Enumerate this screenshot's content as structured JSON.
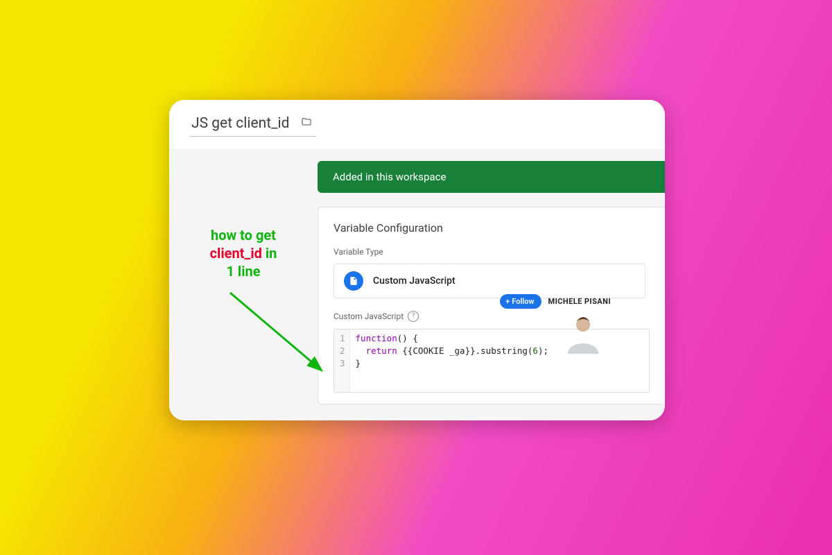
{
  "header": {
    "title": "JS get client_id"
  },
  "banner": {
    "text": "Added in this workspace"
  },
  "config": {
    "section_title": "Variable Configuration",
    "type_label": "Variable Type",
    "type_name": "Custom JavaScript",
    "editor_label": "Custom JavaScript"
  },
  "code": {
    "lines": [
      "1",
      "2",
      "3"
    ],
    "l1_kw": "function",
    "l1_rest": "() {",
    "l2_pre": "  ",
    "l2_kw": "return",
    "l2_mid": " {{COOKIE _ga}}.substring(",
    "l2_num": "6",
    "l2_post": ");",
    "l3": "}"
  },
  "annotation": {
    "line1": "how to get",
    "line2_red": "client_id",
    "line2_rest": " in",
    "line3": "1 line"
  },
  "overlay": {
    "follow_label": "Follow",
    "author_name": "MICHELE PISANI"
  },
  "colors": {
    "banner": "#188038",
    "accent": "#1a73e8"
  }
}
